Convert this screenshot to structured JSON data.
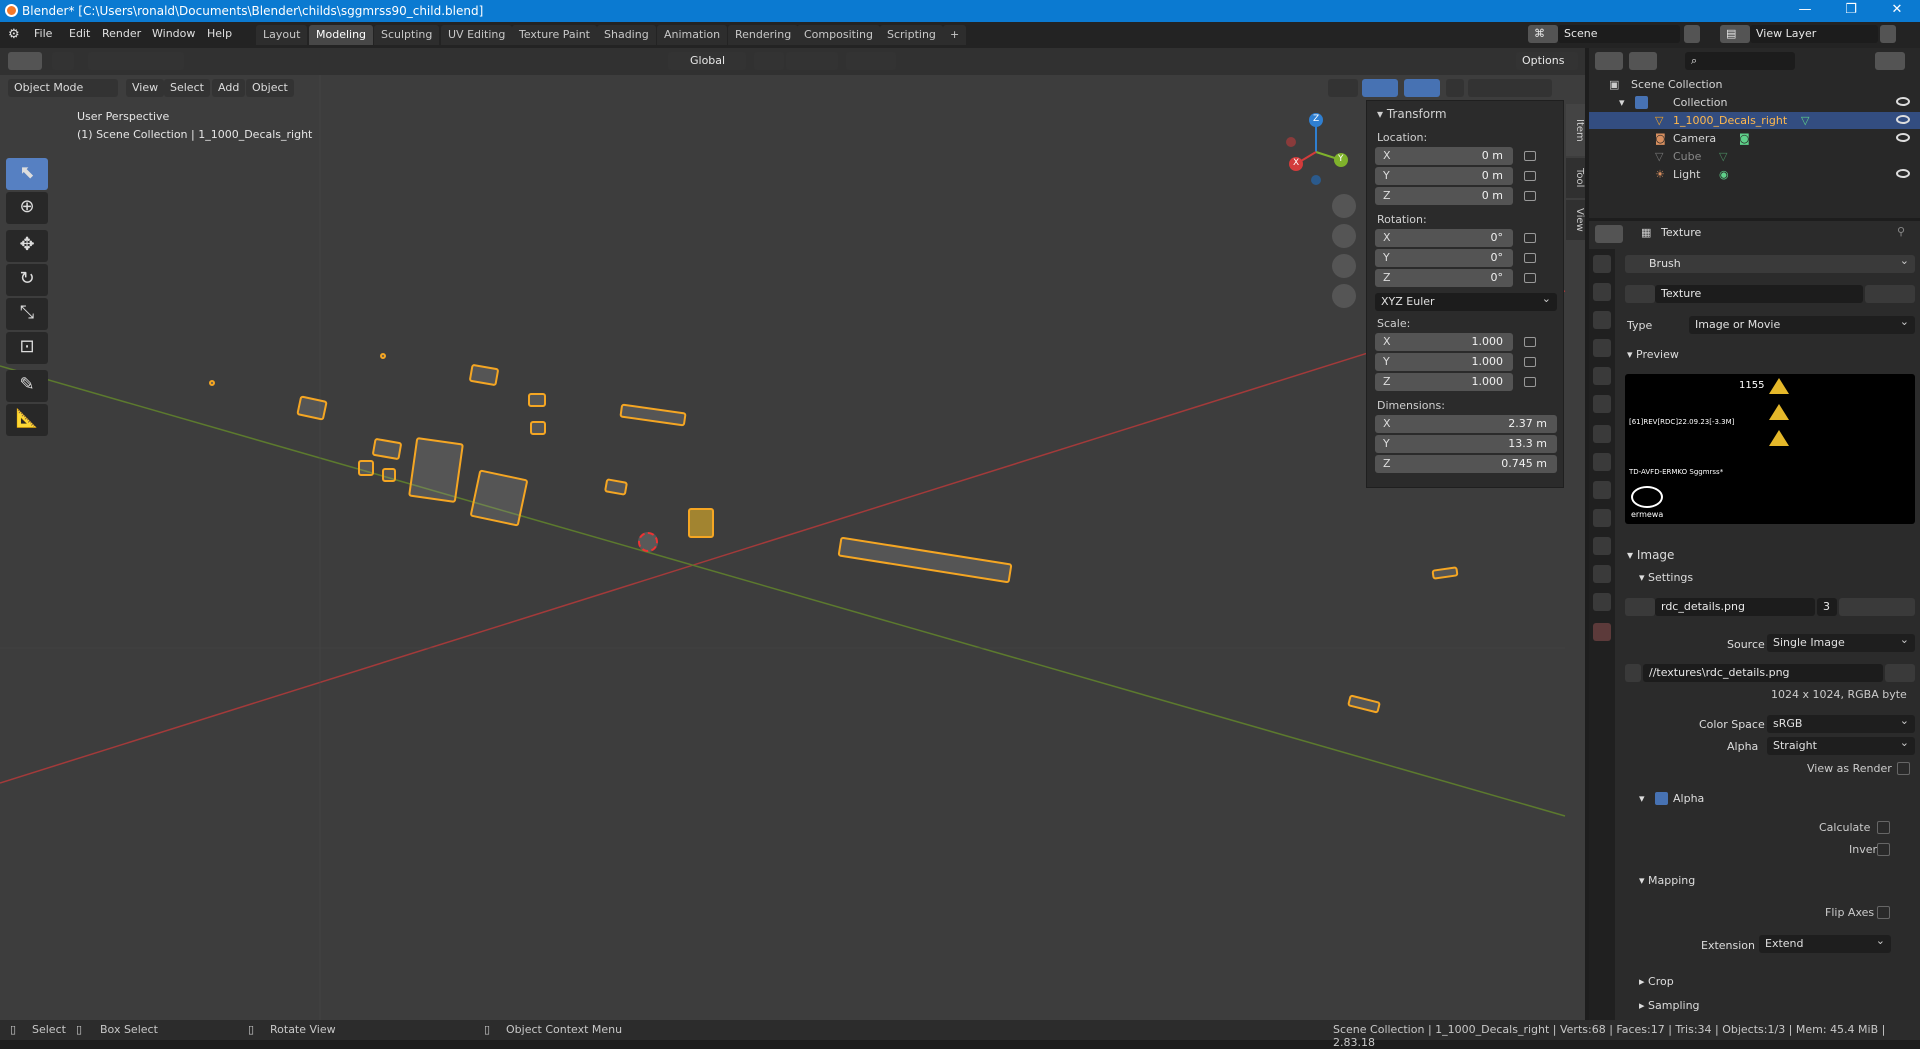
{
  "window": {
    "title": "Blender* [C:\\Users\\ronald\\Documents\\Blender\\childs\\sggmrss90_child.blend]",
    "minimize": "—",
    "maximize": "❐",
    "close": "✕"
  },
  "menubar": {
    "items": [
      "File",
      "Edit",
      "Render",
      "Window",
      "Help"
    ]
  },
  "workspaces": {
    "tabs": [
      "Layout",
      "Modeling",
      "Sculpting",
      "UV Editing",
      "Texture Paint",
      "Shading",
      "Animation",
      "Rendering",
      "Compositing",
      "Scripting"
    ],
    "active": "Modeling",
    "add": "+"
  },
  "scene": {
    "name": "Scene",
    "view_layer": "View Layer"
  },
  "viewport": {
    "mode": "Object Mode",
    "menus": [
      "View",
      "Select",
      "Add",
      "Object"
    ],
    "orientation": "Global",
    "options": "Options",
    "perspective": "User Perspective",
    "context": "(1) Scene Collection | 1_1000_Decals_right",
    "gizmo": {
      "x": "X",
      "y": "Y",
      "z": "Z"
    }
  },
  "npanel": {
    "header": "Transform",
    "location_label": "Location:",
    "location": [
      {
        "axis": "X",
        "value": "0 m"
      },
      {
        "axis": "Y",
        "value": "0 m"
      },
      {
        "axis": "Z",
        "value": "0 m"
      }
    ],
    "rotation_label": "Rotation:",
    "rotation": [
      {
        "axis": "X",
        "value": "0°"
      },
      {
        "axis": "Y",
        "value": "0°"
      },
      {
        "axis": "Z",
        "value": "0°"
      }
    ],
    "rotation_mode": "XYZ Euler",
    "scale_label": "Scale:",
    "scale": [
      {
        "axis": "X",
        "value": "1.000"
      },
      {
        "axis": "Y",
        "value": "1.000"
      },
      {
        "axis": "Z",
        "value": "1.000"
      }
    ],
    "dimensions_label": "Dimensions:",
    "dimensions": [
      {
        "axis": "X",
        "value": "2.37 m"
      },
      {
        "axis": "Y",
        "value": "13.3 m"
      },
      {
        "axis": "Z",
        "value": "0.745 m"
      }
    ],
    "tabs": [
      "Item",
      "Tool",
      "View"
    ]
  },
  "outliner": {
    "root": "Scene Collection",
    "collection": "Collection",
    "items": [
      {
        "name": "1_1000_Decals_right",
        "selected": true
      },
      {
        "name": "Camera",
        "selected": false
      },
      {
        "name": "Cube",
        "selected": false
      },
      {
        "name": "Light",
        "selected": false
      }
    ]
  },
  "properties": {
    "title": "Texture",
    "brush": "Brush",
    "texture_name": "Texture",
    "type_label": "Type",
    "type_value": "Image or Movie",
    "preview_label": "Preview",
    "preview_text": {
      "number": "1155",
      "code": "[61]REV[RDC]22.09.23[-3.3M]",
      "brand_line": "TD-AVFD-ERMKO Sggmrss*",
      "logo": "ermewa"
    },
    "image_label": "Image",
    "settings_label": "Settings",
    "image_name": "rdc_details.png",
    "image_users": "3",
    "source_label": "Source",
    "source_value": "Single Image",
    "filepath": "//textures\\rdc_details.png",
    "resolution": "1024 x 1024,  RGBA byte",
    "color_space_label": "Color Space",
    "color_space_value": "sRGB",
    "alpha_label": "Alpha",
    "alpha_value": "Straight",
    "view_as_render": "View as Render",
    "alpha_section": "Alpha",
    "calculate": "Calculate",
    "invert": "Invert",
    "mapping_label": "Mapping",
    "flip_axes": "Flip Axes",
    "extension_label": "Extension",
    "extension_value": "Extend",
    "crop_label": "Crop",
    "sampling_label": "Sampling"
  },
  "statusbar": {
    "select": "Select",
    "box_select": "Box Select",
    "rotate_view": "Rotate View",
    "context_menu": "Object Context Menu",
    "stats": "Scene Collection | 1_1000_Decals_right | Verts:68 | Faces:17 | Tris:34 | Objects:1/3 | Mem: 45.4 MiB | 2.83.18"
  },
  "colors": {
    "accent": "#4772b3",
    "selection": "#f5a623",
    "titlebar": "#0b7ad1"
  }
}
